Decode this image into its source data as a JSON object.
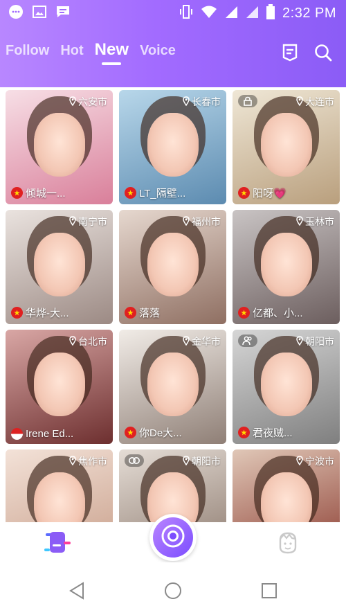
{
  "status_bar": {
    "time": "2:32 PM",
    "left_icons": [
      "chat-bubble-icon",
      "image-icon",
      "message-icon"
    ],
    "right_icons": [
      "vibrate-icon",
      "wifi-icon",
      "signal-icon",
      "signal-icon",
      "battery-icon"
    ]
  },
  "tabs": [
    {
      "label": "Follow",
      "active": false
    },
    {
      "label": "Hot",
      "active": false
    },
    {
      "label": "New",
      "active": true
    },
    {
      "label": "Voice",
      "active": false
    }
  ],
  "header_icons": [
    "ranking-icon",
    "search-icon"
  ],
  "cards": [
    {
      "location": "六安市",
      "name": "倾城一...",
      "flag": "cn",
      "photo": [
        "#f7dfe6",
        "#d97f9a"
      ],
      "badge": ""
    },
    {
      "location": "长春市",
      "name": "LT_隔壁...",
      "flag": "cn",
      "photo": [
        "#b8d7ea",
        "#5c8bb0"
      ],
      "badge": ""
    },
    {
      "location": "大连市",
      "name": "阳呀💗",
      "flag": "cn",
      "photo": [
        "#efe7d6",
        "#b99f7d"
      ],
      "badge": "lock-icon"
    },
    {
      "location": "南宁市",
      "name": "华烨-大...",
      "flag": "cn",
      "photo": [
        "#eae3df",
        "#9c8a84"
      ],
      "badge": ""
    },
    {
      "location": "福州市",
      "name": "落落",
      "flag": "cn",
      "photo": [
        "#e6d8cf",
        "#8f6f62"
      ],
      "badge": ""
    },
    {
      "location": "玉林市",
      "name": "亿都、小...",
      "flag": "cn",
      "photo": [
        "#c9c4c4",
        "#6c5e5e"
      ],
      "badge": ""
    },
    {
      "location": "台北市",
      "name": "Irene Ed...",
      "flag": "us",
      "photo": [
        "#d9a7a5",
        "#6d2f2f"
      ],
      "badge": ""
    },
    {
      "location": "金华市",
      "name": "你De大...",
      "flag": "cn",
      "photo": [
        "#f1ece7",
        "#8f7f76"
      ],
      "badge": ""
    },
    {
      "location": "朝阳市",
      "name": "君夜贼...",
      "flag": "cn",
      "photo": [
        "#d6d6d6",
        "#7f7f7f"
      ],
      "badge": "people-icon"
    },
    {
      "location": "焦作市",
      "name": "",
      "flag": "",
      "photo": [
        "#f3e2d8",
        "#c79d88"
      ],
      "badge": ""
    },
    {
      "location": "朝阳市",
      "name": "",
      "flag": "",
      "photo": [
        "#e5ddd6",
        "#8a776b"
      ],
      "badge": "link-icon"
    },
    {
      "location": "宁波市",
      "name": "",
      "flag": "",
      "photo": [
        "#e0c7b7",
        "#8a3a2f"
      ],
      "badge": ""
    }
  ],
  "bottom_nav": {
    "feed_icon": "feed-icon",
    "camera_icon": "camera-icon",
    "profile_icon": "profile-icon"
  },
  "system_nav": [
    "back-icon",
    "home-icon",
    "recents-icon"
  ],
  "colors": {
    "header_start": "#b887ff",
    "header_end": "#8b5cf6",
    "accent": "#7c4dff"
  }
}
